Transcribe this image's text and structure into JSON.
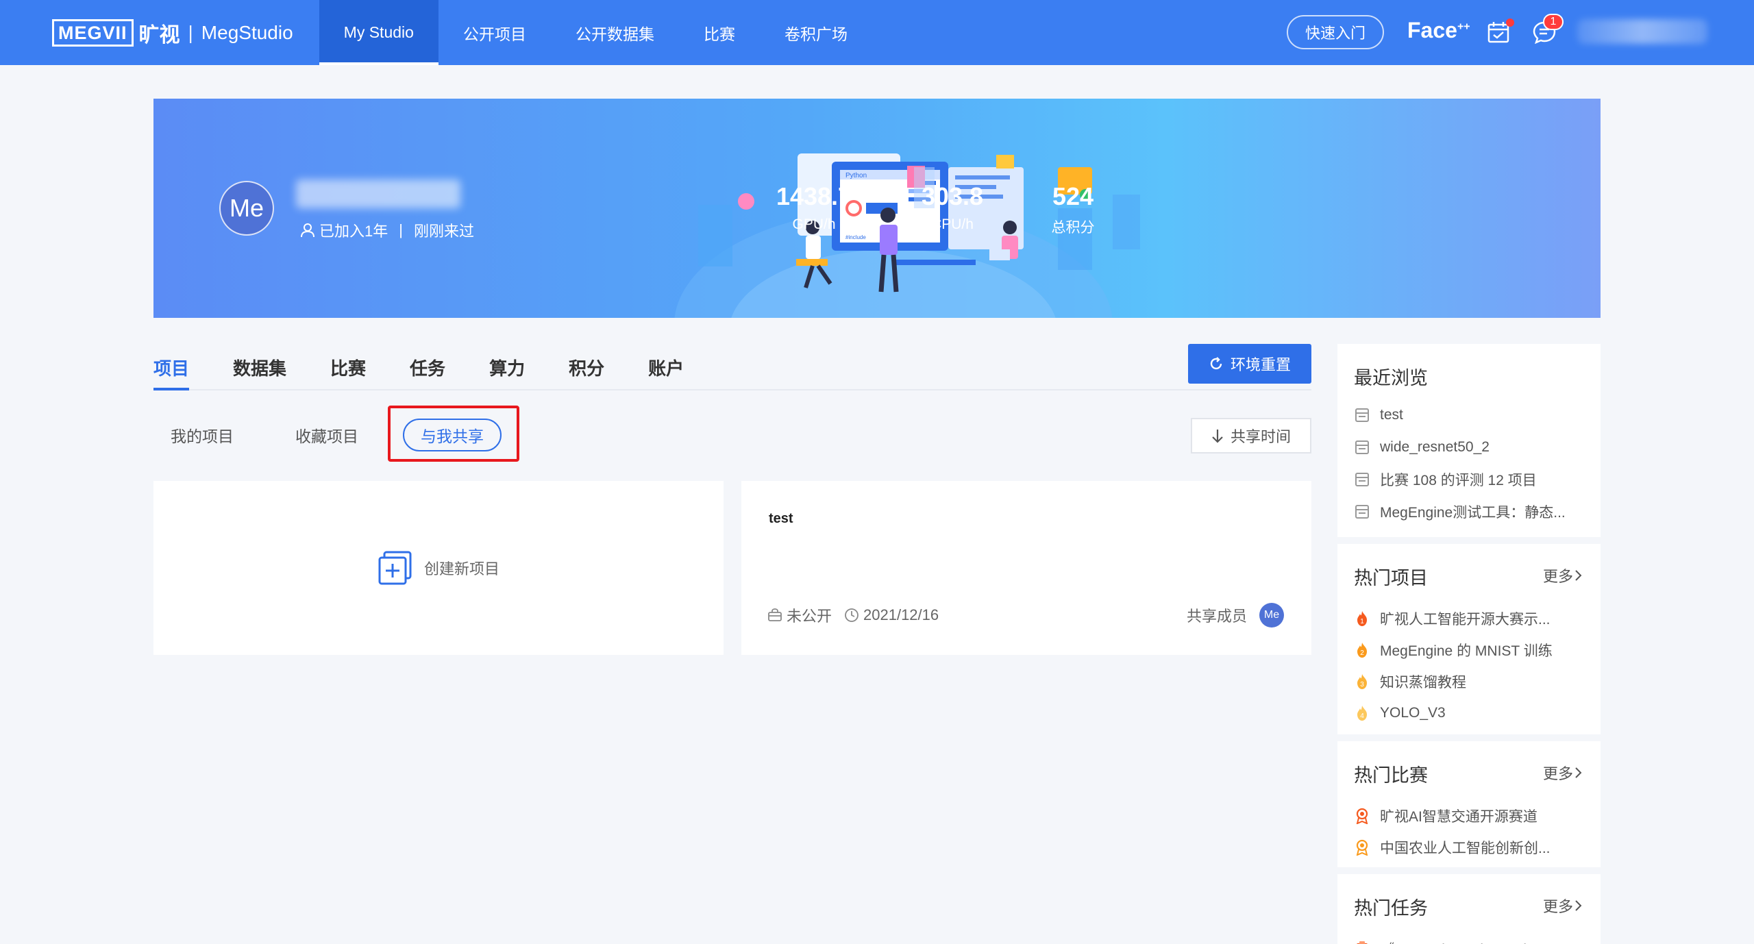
{
  "navbar": {
    "logo_mark": "MEGVII",
    "logo_cn": "旷视",
    "logo_sep": "|",
    "logo_studio": "MegStudio",
    "items": [
      {
        "label": "My Studio"
      },
      {
        "label": "公开项目"
      },
      {
        "label": "公开数据集"
      },
      {
        "label": "比赛"
      },
      {
        "label": "卷积广场"
      }
    ],
    "quick_start": "快速入门",
    "face_logo": "Face",
    "face_logo_sup": "++",
    "msg_badge": "1"
  },
  "banner": {
    "avatar_text": "Me",
    "joined": "已加入1年",
    "separator": "|",
    "last_visit": "刚刚来过",
    "stats": [
      {
        "value": "1438.7",
        "label": "GPU/h"
      },
      {
        "value": "303.8",
        "label": "CPU/h"
      },
      {
        "value": "524",
        "label": "总积分"
      }
    ],
    "illustration_text_1": "Python",
    "illustration_text_2": "#include"
  },
  "tabs": [
    {
      "label": "项目"
    },
    {
      "label": "数据集"
    },
    {
      "label": "比赛"
    },
    {
      "label": "任务"
    },
    {
      "label": "算力"
    },
    {
      "label": "积分"
    },
    {
      "label": "账户"
    }
  ],
  "reset_button": "环境重置",
  "subtabs": [
    {
      "label": "我的项目"
    },
    {
      "label": "收藏项目"
    },
    {
      "label": "与我共享"
    }
  ],
  "sort_button": "共享时间",
  "create_card": {
    "label": "创建新项目"
  },
  "project_card": {
    "title": "test",
    "visibility": "未公开",
    "date": "2021/12/16",
    "shared_label": "共享成员",
    "member_avatar": "Me"
  },
  "sidebar": {
    "recent": {
      "title": "最近浏览",
      "items": [
        {
          "label": "test"
        },
        {
          "label": "wide_resnet50_2"
        },
        {
          "label": "比赛 108 的评测 12 项目"
        },
        {
          "label": "MegEngine测试工具：静态..."
        }
      ]
    },
    "hot_projects": {
      "title": "热门项目",
      "more": "更多",
      "items": [
        {
          "label": "旷视人工智能开源大赛示...",
          "rank": "1"
        },
        {
          "label": "MegEngine 的 MNIST 训练",
          "rank": "2"
        },
        {
          "label": "知识蒸馏教程",
          "rank": "3"
        },
        {
          "label": "YOLO_V3",
          "rank": "4"
        }
      ]
    },
    "hot_competitions": {
      "title": "热门比赛",
      "more": "更多",
      "items": [
        {
          "label": "旷视AI智慧交通开源赛道"
        },
        {
          "label": "中国农业人工智能创新创..."
        }
      ]
    },
    "hot_tasks": {
      "title": "热门任务",
      "more": "更多",
      "items": [
        {
          "label": "《You Only Look One-lev..."
        }
      ]
    }
  },
  "colors": {
    "primary": "#2f6fe8",
    "navbar": "#3b7ef2",
    "highlight": "#e8181d",
    "badge": "#ff3b3b"
  }
}
